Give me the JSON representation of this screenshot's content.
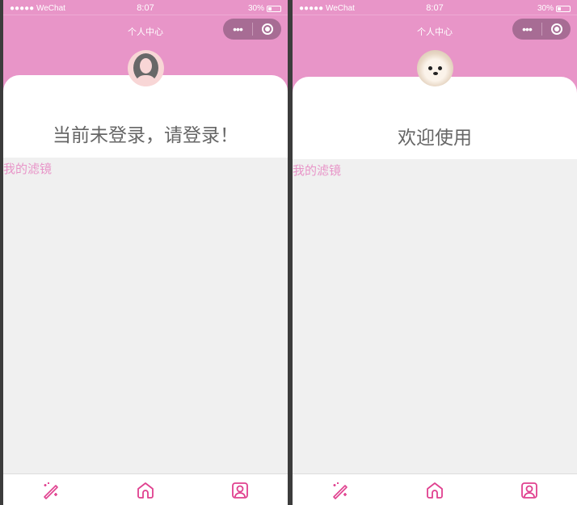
{
  "status_bar": {
    "carrier": "●●●●● WeChat",
    "time": "8:07",
    "battery": "30%"
  },
  "nav": {
    "title": "个人中心",
    "more_icon": "•••"
  },
  "screens": [
    {
      "message": "当前未登录，请登录！",
      "avatar": "default-avatar",
      "section_label": "我的滤镜"
    },
    {
      "message": "欢迎使用",
      "avatar": "dog-photo-avatar",
      "section_label": "我的滤镜"
    }
  ],
  "tabs": [
    {
      "icon": "magic-wand-icon"
    },
    {
      "icon": "home-icon"
    },
    {
      "icon": "user-profile-icon"
    }
  ],
  "colors": {
    "accent": "#e895c8",
    "icon": "#e0408f",
    "capsule": "#a76c94"
  }
}
